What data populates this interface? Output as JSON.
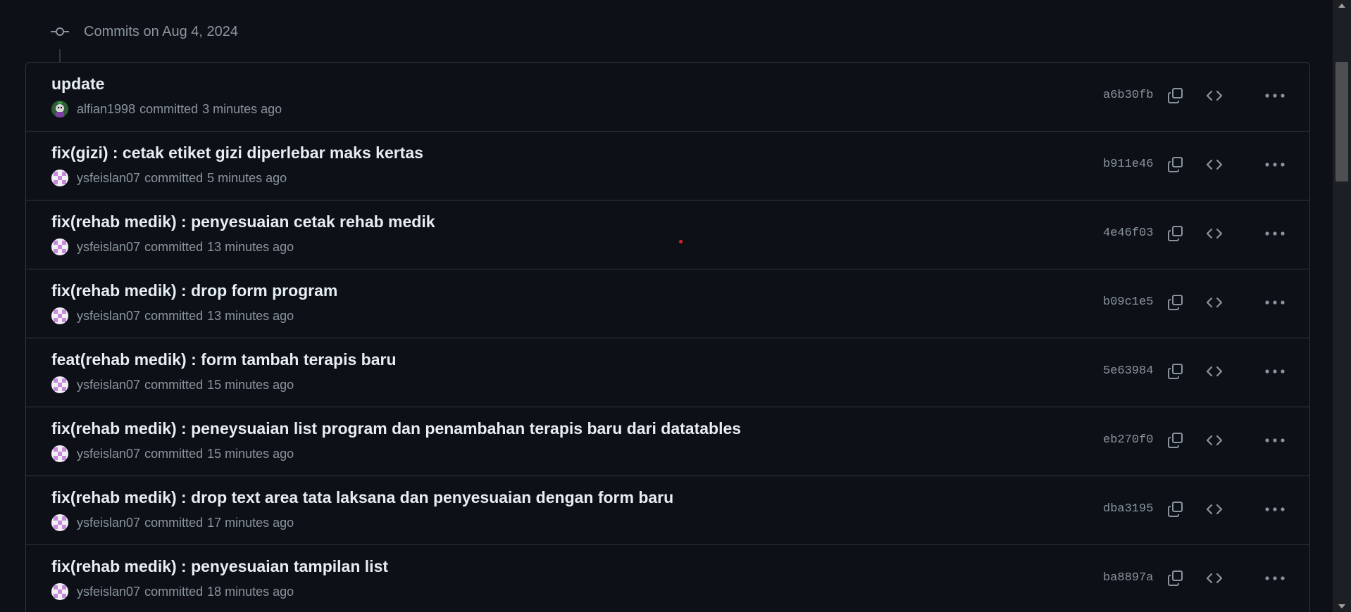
{
  "group": {
    "title": "Commits on Aug 4, 2024",
    "icon": "git-commit-icon"
  },
  "commits": [
    {
      "message": "update",
      "author": "alfian1998",
      "verb": "committed",
      "time": "3 minutes ago",
      "sha": "a6b30fb",
      "avatar": "avatar-alfian"
    },
    {
      "message": "fix(gizi) : cetak etiket gizi diperlebar maks kertas",
      "author": "ysfeislan07",
      "verb": "committed",
      "time": "5 minutes ago",
      "sha": "b911e46",
      "avatar": "avatar-ysfeislan"
    },
    {
      "message": "fix(rehab medik) : penyesuaian cetak rehab medik",
      "author": "ysfeislan07",
      "verb": "committed",
      "time": "13 minutes ago",
      "sha": "4e46f03",
      "avatar": "avatar-ysfeislan"
    },
    {
      "message": "fix(rehab medik) : drop form program",
      "author": "ysfeislan07",
      "verb": "committed",
      "time": "13 minutes ago",
      "sha": "b09c1e5",
      "avatar": "avatar-ysfeislan"
    },
    {
      "message": "feat(rehab medik) : form tambah terapis baru",
      "author": "ysfeislan07",
      "verb": "committed",
      "time": "15 minutes ago",
      "sha": "5e63984",
      "avatar": "avatar-ysfeislan"
    },
    {
      "message": "fix(rehab medik) : peneysuaian list program dan penambahan terapis baru dari datatables",
      "author": "ysfeislan07",
      "verb": "committed",
      "time": "15 minutes ago",
      "sha": "eb270f0",
      "avatar": "avatar-ysfeislan"
    },
    {
      "message": "fix(rehab medik) : drop text area tata laksana dan penyesuaian dengan form baru",
      "author": "ysfeislan07",
      "verb": "committed",
      "time": "17 minutes ago",
      "sha": "dba3195",
      "avatar": "avatar-ysfeislan"
    },
    {
      "message": "fix(rehab medik) : penyesuaian tampilan list",
      "author": "ysfeislan07",
      "verb": "committed",
      "time": "18 minutes ago",
      "sha": "ba8897a",
      "avatar": "avatar-ysfeislan"
    }
  ],
  "actions": {
    "copy_icon": "copy-icon",
    "browse_icon": "code-icon",
    "more_icon": "kebab-horizontal-icon"
  },
  "colors": {
    "background": "#0d1117",
    "border": "#30363d",
    "text": "#e6edf3",
    "muted": "#8b949e"
  }
}
